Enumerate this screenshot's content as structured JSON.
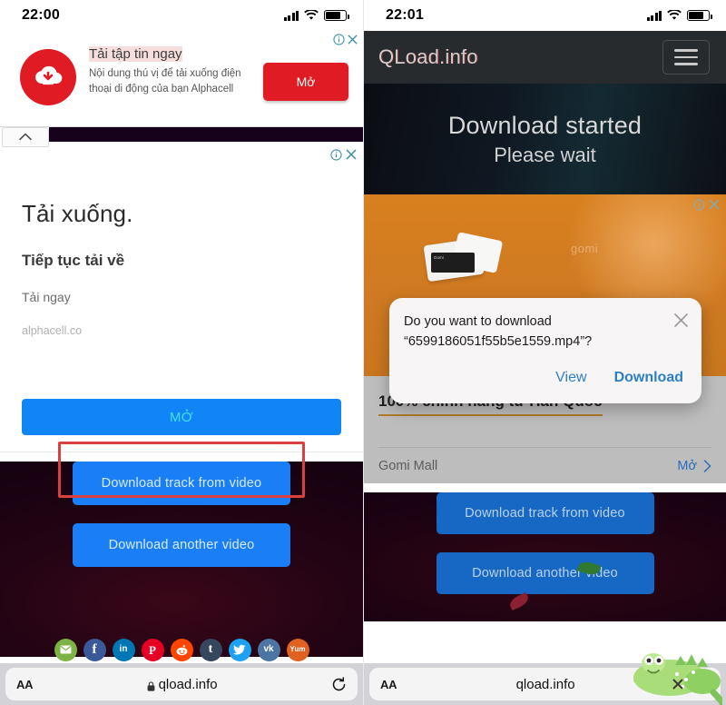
{
  "left_phone": {
    "status": {
      "time": "22:00",
      "signal_icon": "signal-bars-icon",
      "wifi_icon": "wifi-icon",
      "battery_icon": "battery-icon"
    },
    "ad_banner": {
      "icon": "cloud-download-icon",
      "title": "Tải tập tin ngay",
      "description": "Nội dung thú vị để tải xuống điện thoại di động của bạn Alphacell",
      "cta_label": "Mở",
      "info_icon": "ad-info-icon",
      "close_icon": "ad-close-icon"
    },
    "collapse_tab": {
      "icon": "chevron-up-icon"
    },
    "interstitial": {
      "heading": "Tải xuống.",
      "subheading": "Tiếp tục tải về",
      "line1": "Tải ngay",
      "line2": "alphacell.co",
      "open_button": "MỞ",
      "info_icon": "ad-info-icon",
      "close_icon": "ad-close-icon"
    },
    "page": {
      "download_track_button": "Download track from video",
      "download_another_button": "Download another video",
      "highlight_color": "#d94040"
    },
    "social": [
      {
        "name": "email",
        "label": "✉"
      },
      {
        "name": "facebook",
        "label": "f"
      },
      {
        "name": "linkedin",
        "label": "in"
      },
      {
        "name": "pinterest",
        "label": "P"
      },
      {
        "name": "reddit",
        "label": "r"
      },
      {
        "name": "tumblr",
        "label": "t"
      },
      {
        "name": "twitter",
        "label": "t"
      },
      {
        "name": "vk",
        "label": "vk"
      },
      {
        "name": "yummly",
        "label": "Yum"
      }
    ],
    "browser": {
      "text_size_label": "AA",
      "url": "qload.info",
      "lock_icon": "lock-icon",
      "reload_icon": "reload-icon"
    }
  },
  "right_phone": {
    "status": {
      "time": "22:01",
      "signal_icon": "signal-bars-icon",
      "wifi_icon": "wifi-icon",
      "battery_icon": "battery-icon"
    },
    "site_header": {
      "logo": "QLoad.info",
      "menu_icon": "hamburger-menu-icon"
    },
    "hero": {
      "line1": "Download started",
      "line2": "Please wait"
    },
    "gomi_ad": {
      "watermark": "gomi",
      "info_icon": "ad-info-icon",
      "close_icon": "ad-close-icon",
      "product_label": "Gomi"
    },
    "native_ad": {
      "headline": "100% chính hãng từ Hàn Quốc",
      "source": "Gomi Mall",
      "open_label": "Mở",
      "chevron_icon": "chevron-right-icon"
    },
    "download_dialog": {
      "message": "Do you want to download “6599186051f55b5e1559.mp4”?",
      "close_icon": "close-icon",
      "view_label": "View",
      "download_label": "Download",
      "highlight_color": "#d94040"
    },
    "page": {
      "download_track_button": "Download track from video",
      "download_another_button": "Download another video"
    },
    "mascot": "crocodile-watermark-icon",
    "browser": {
      "text_size_label": "AA",
      "url": "qload.info",
      "reload_icon": "reload-icon"
    }
  }
}
